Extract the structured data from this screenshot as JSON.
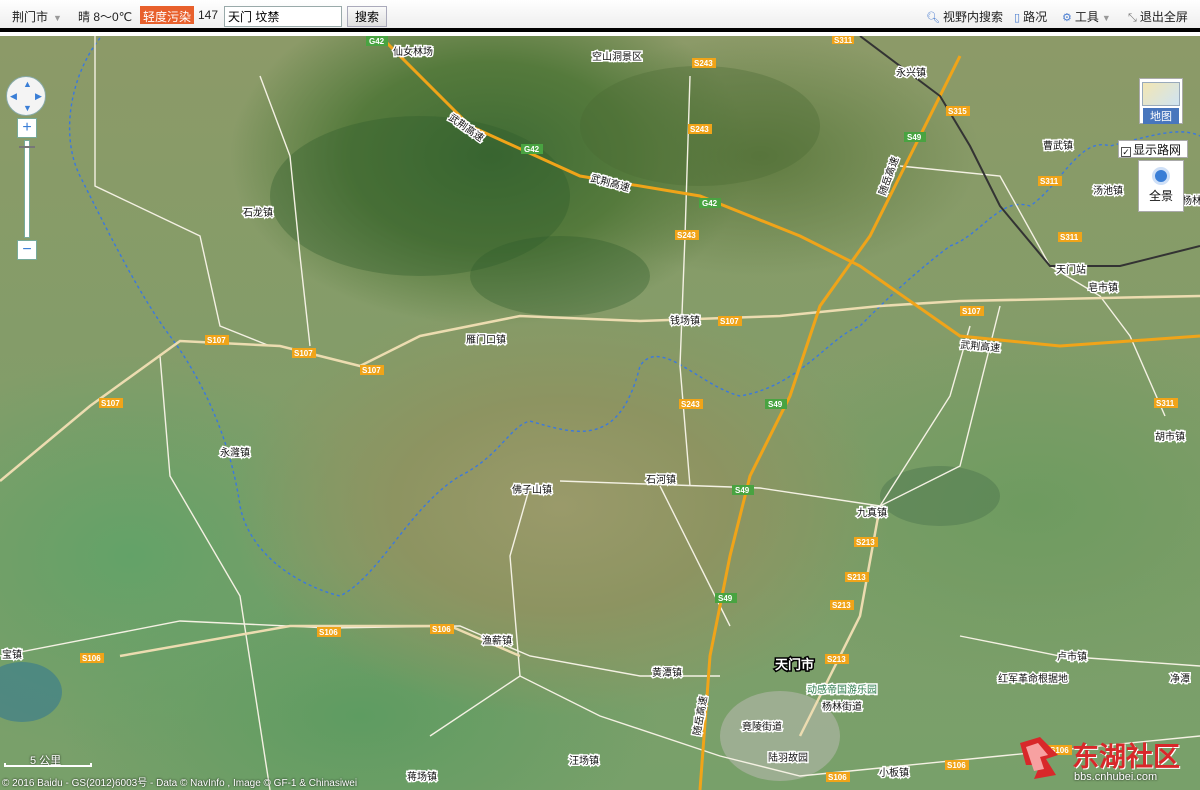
{
  "topbar": {
    "city": "荆门市",
    "weather": "晴 8～0℃",
    "aqi_label": "轻度污染",
    "aqi_value": "147",
    "search_value": "天门 坟禁",
    "search_button": "搜索",
    "search_in_view": "视野内搜索",
    "traffic": "路况",
    "tools": "工具",
    "exit_fullscreen": "退出全屏"
  },
  "map_controls": {
    "map_type": "地图",
    "show_road_network": "显示路网",
    "panorama": "全景",
    "scale": "5 公里"
  },
  "place_labels": [
    "仙女林场",
    "空山洞景区",
    "永兴镇",
    "皂市镇",
    "石龙镇",
    "钱场镇",
    "雁门口镇",
    "天门站",
    "汤池镇",
    "杨林",
    "永漋镇",
    "胡市镇",
    "石河镇",
    "佛子山镇",
    "九真镇",
    "渔薪镇",
    "宝镇",
    "天门市",
    "卢市镇",
    "红军革命根据地",
    "净潭",
    "竟陵街道",
    "杨林街道",
    "黄潭镇",
    "陆羽故园",
    "汪场镇",
    "蒋场镇",
    "小板镇",
    "动感帝国游乐园",
    "曹武镇"
  ],
  "road_labels": [
    "G42",
    "G42",
    "S243",
    "S243",
    "S243",
    "S243",
    "S49",
    "S49",
    "S49",
    "S49",
    "S107",
    "S107",
    "S107",
    "S107",
    "S107",
    "S107",
    "S311",
    "S311",
    "S311",
    "S311",
    "S315",
    "S213",
    "S213",
    "S213",
    "S213",
    "S106",
    "S106",
    "S106",
    "S106",
    "S106",
    "S106",
    "武荆高速",
    "武荆高速",
    "武荆高速",
    "随岳高速",
    "随岳高速"
  ],
  "copyright": "© 2016 Baidu - GS(2012)6003号 - Data © NavInfo , Image © GF-1 & Chinasiwei",
  "watermark": {
    "title": "东湖社区",
    "url": "bbs.cnhubei.com"
  },
  "colors": {
    "aqi_badge": "#e8602c",
    "expressway": "#f0a419",
    "provincial_shield": "#f0a419",
    "national_shield": "#49a341",
    "river": "#3a78e0",
    "accent": "#3a7ed6",
    "watermark_red": "#d8282a"
  }
}
